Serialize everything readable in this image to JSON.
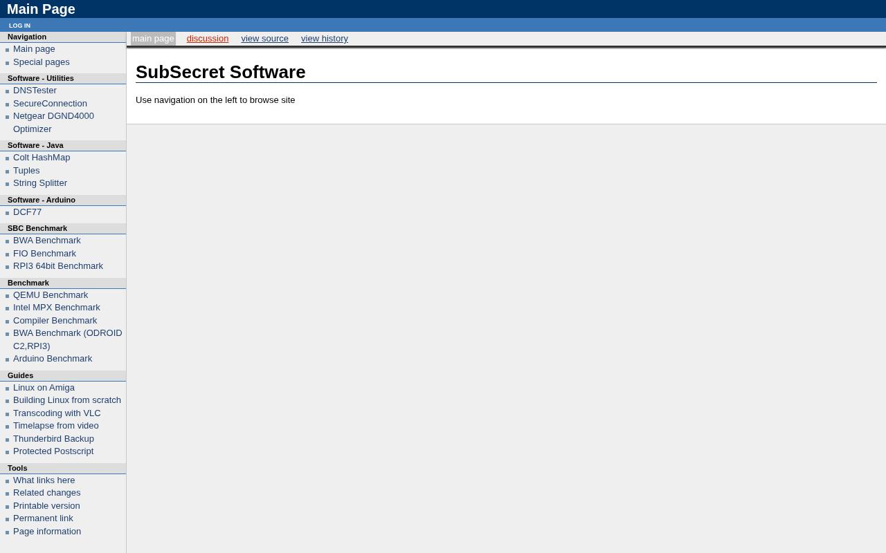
{
  "header": {
    "title": "Main Page"
  },
  "user_bar": {
    "login": "LOG IN"
  },
  "sidebar": [
    {
      "heading": "Navigation",
      "items": [
        "Main page",
        "Special pages"
      ]
    },
    {
      "heading": "Software - Utilities",
      "items": [
        "DNSTester",
        "SecureConnection",
        "Netgear DGND4000 Optimizer"
      ]
    },
    {
      "heading": "Software - Java",
      "items": [
        "Colt HashMap",
        "Tuples",
        "String Splitter"
      ]
    },
    {
      "heading": "Software - Arduino",
      "items": [
        "DCF77"
      ]
    },
    {
      "heading": "SBC Benchmark",
      "items": [
        "BWA Benchmark",
        "FIO Benchmark",
        "RPI3 64bit Benchmark"
      ]
    },
    {
      "heading": "Benchmark",
      "items": [
        "QEMU Benchmark",
        "Intel MPX Benchmark",
        "Compiler Benchmark",
        "BWA Benchmark (ODROID C2,RPI3)",
        "Arduino Benchmark"
      ]
    },
    {
      "heading": "Guides",
      "items": [
        "Linux on Amiga",
        "Building Linux from scratch",
        "Transcoding with VLC",
        "Timelapse from video",
        "Thunderbird Backup",
        "Protected Postscript"
      ]
    },
    {
      "heading": "Tools",
      "items": [
        "What links here",
        "Related changes",
        "Printable version",
        "Permanent link",
        "Page information"
      ]
    }
  ],
  "tabs": [
    {
      "label": "main page",
      "selected": true,
      "exists": true
    },
    {
      "label": "discussion",
      "selected": false,
      "exists": false
    },
    {
      "label": "view source",
      "selected": false,
      "exists": true
    },
    {
      "label": "view history",
      "selected": false,
      "exists": true
    }
  ],
  "content": {
    "title": "SubSecret Software",
    "text": "Use navigation on the left to browse site"
  }
}
